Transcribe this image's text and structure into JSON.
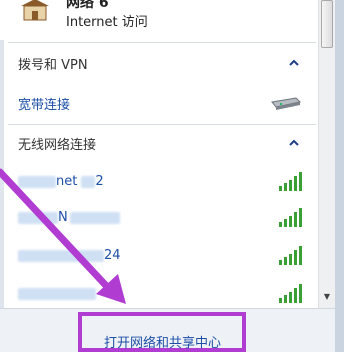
{
  "current_connection": {
    "name": "网络 6",
    "status": "Internet 访问",
    "icon": "network-home-icon"
  },
  "sections": [
    {
      "title": "拨号和 VPN",
      "icon": "chevron-up-icon",
      "items": [
        {
          "label": "宽带连接",
          "icon": "broadband-modem-icon"
        }
      ]
    },
    {
      "title": "无线网络连接",
      "icon": "chevron-up-icon",
      "items": [
        {
          "label_visible": "net",
          "label_suffix": "2",
          "icon": "wifi-signal-full-icon"
        },
        {
          "label_visible": "N",
          "label_suffix": "",
          "icon": "wifi-signal-full-icon"
        },
        {
          "label_visible": "",
          "label_suffix": "24",
          "icon": "wifi-signal-full-icon"
        },
        {
          "label_visible": "",
          "label_suffix": "",
          "icon": "wifi-signal-full-icon"
        }
      ]
    }
  ],
  "footer": {
    "link": "打开网络和共享中心"
  },
  "colors": {
    "link": "#1c4fa6",
    "signal": "#3aa035",
    "annotation": "#b03cd2"
  }
}
